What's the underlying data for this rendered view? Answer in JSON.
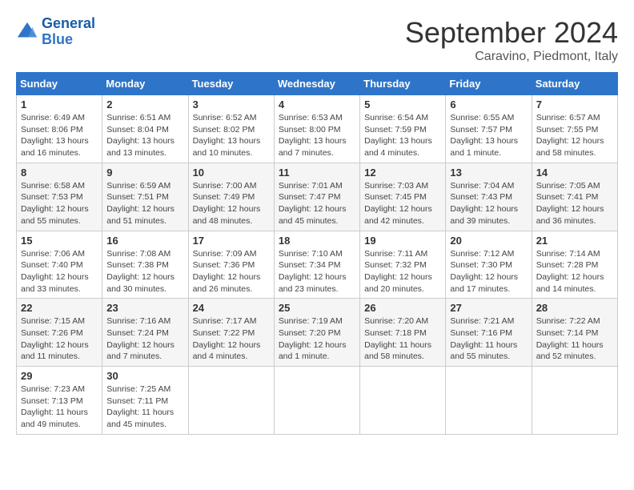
{
  "logo": {
    "line1": "General",
    "line2": "Blue"
  },
  "title": "September 2024",
  "subtitle": "Caravino, Piedmont, Italy",
  "weekdays": [
    "Sunday",
    "Monday",
    "Tuesday",
    "Wednesday",
    "Thursday",
    "Friday",
    "Saturday"
  ],
  "weeks": [
    [
      {
        "day": "1",
        "detail": "Sunrise: 6:49 AM\nSunset: 8:06 PM\nDaylight: 13 hours\nand 16 minutes."
      },
      {
        "day": "2",
        "detail": "Sunrise: 6:51 AM\nSunset: 8:04 PM\nDaylight: 13 hours\nand 13 minutes."
      },
      {
        "day": "3",
        "detail": "Sunrise: 6:52 AM\nSunset: 8:02 PM\nDaylight: 13 hours\nand 10 minutes."
      },
      {
        "day": "4",
        "detail": "Sunrise: 6:53 AM\nSunset: 8:00 PM\nDaylight: 13 hours\nand 7 minutes."
      },
      {
        "day": "5",
        "detail": "Sunrise: 6:54 AM\nSunset: 7:59 PM\nDaylight: 13 hours\nand 4 minutes."
      },
      {
        "day": "6",
        "detail": "Sunrise: 6:55 AM\nSunset: 7:57 PM\nDaylight: 13 hours\nand 1 minute."
      },
      {
        "day": "7",
        "detail": "Sunrise: 6:57 AM\nSunset: 7:55 PM\nDaylight: 12 hours\nand 58 minutes."
      }
    ],
    [
      {
        "day": "8",
        "detail": "Sunrise: 6:58 AM\nSunset: 7:53 PM\nDaylight: 12 hours\nand 55 minutes."
      },
      {
        "day": "9",
        "detail": "Sunrise: 6:59 AM\nSunset: 7:51 PM\nDaylight: 12 hours\nand 51 minutes."
      },
      {
        "day": "10",
        "detail": "Sunrise: 7:00 AM\nSunset: 7:49 PM\nDaylight: 12 hours\nand 48 minutes."
      },
      {
        "day": "11",
        "detail": "Sunrise: 7:01 AM\nSunset: 7:47 PM\nDaylight: 12 hours\nand 45 minutes."
      },
      {
        "day": "12",
        "detail": "Sunrise: 7:03 AM\nSunset: 7:45 PM\nDaylight: 12 hours\nand 42 minutes."
      },
      {
        "day": "13",
        "detail": "Sunrise: 7:04 AM\nSunset: 7:43 PM\nDaylight: 12 hours\nand 39 minutes."
      },
      {
        "day": "14",
        "detail": "Sunrise: 7:05 AM\nSunset: 7:41 PM\nDaylight: 12 hours\nand 36 minutes."
      }
    ],
    [
      {
        "day": "15",
        "detail": "Sunrise: 7:06 AM\nSunset: 7:40 PM\nDaylight: 12 hours\nand 33 minutes."
      },
      {
        "day": "16",
        "detail": "Sunrise: 7:08 AM\nSunset: 7:38 PM\nDaylight: 12 hours\nand 30 minutes."
      },
      {
        "day": "17",
        "detail": "Sunrise: 7:09 AM\nSunset: 7:36 PM\nDaylight: 12 hours\nand 26 minutes."
      },
      {
        "day": "18",
        "detail": "Sunrise: 7:10 AM\nSunset: 7:34 PM\nDaylight: 12 hours\nand 23 minutes."
      },
      {
        "day": "19",
        "detail": "Sunrise: 7:11 AM\nSunset: 7:32 PM\nDaylight: 12 hours\nand 20 minutes."
      },
      {
        "day": "20",
        "detail": "Sunrise: 7:12 AM\nSunset: 7:30 PM\nDaylight: 12 hours\nand 17 minutes."
      },
      {
        "day": "21",
        "detail": "Sunrise: 7:14 AM\nSunset: 7:28 PM\nDaylight: 12 hours\nand 14 minutes."
      }
    ],
    [
      {
        "day": "22",
        "detail": "Sunrise: 7:15 AM\nSunset: 7:26 PM\nDaylight: 12 hours\nand 11 minutes."
      },
      {
        "day": "23",
        "detail": "Sunrise: 7:16 AM\nSunset: 7:24 PM\nDaylight: 12 hours\nand 7 minutes."
      },
      {
        "day": "24",
        "detail": "Sunrise: 7:17 AM\nSunset: 7:22 PM\nDaylight: 12 hours\nand 4 minutes."
      },
      {
        "day": "25",
        "detail": "Sunrise: 7:19 AM\nSunset: 7:20 PM\nDaylight: 12 hours\nand 1 minute."
      },
      {
        "day": "26",
        "detail": "Sunrise: 7:20 AM\nSunset: 7:18 PM\nDaylight: 11 hours\nand 58 minutes."
      },
      {
        "day": "27",
        "detail": "Sunrise: 7:21 AM\nSunset: 7:16 PM\nDaylight: 11 hours\nand 55 minutes."
      },
      {
        "day": "28",
        "detail": "Sunrise: 7:22 AM\nSunset: 7:14 PM\nDaylight: 11 hours\nand 52 minutes."
      }
    ],
    [
      {
        "day": "29",
        "detail": "Sunrise: 7:23 AM\nSunset: 7:13 PM\nDaylight: 11 hours\nand 49 minutes."
      },
      {
        "day": "30",
        "detail": "Sunrise: 7:25 AM\nSunset: 7:11 PM\nDaylight: 11 hours\nand 45 minutes."
      },
      null,
      null,
      null,
      null,
      null
    ]
  ]
}
